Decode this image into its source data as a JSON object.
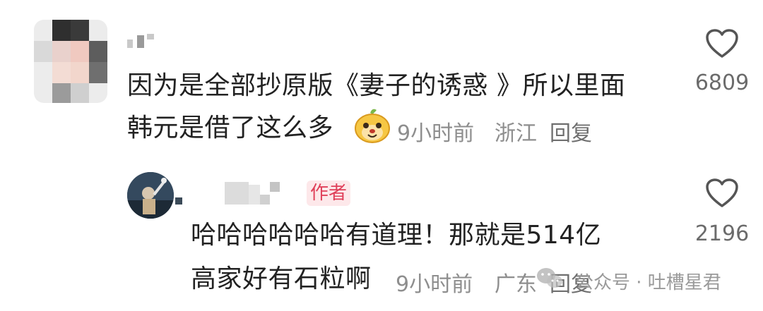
{
  "comments": [
    {
      "text_line1": "因为是全部抄原版《妻子的诱惑 》所以里面",
      "text_line2": "韩元是借了这么多",
      "emoji_icon": "cute-face-emoji",
      "time": "9小时前",
      "location": "浙江",
      "reply_label": "回复",
      "like_count": "6809"
    },
    {
      "badge": "作者",
      "text_line1": "哈哈哈哈哈哈有道理！那就是514亿",
      "text_line2": "高家好有石粒啊",
      "time": "9小时前",
      "location": "广东",
      "reply_label": "回复",
      "like_count": "2196"
    }
  ],
  "watermark": {
    "text": "公众号 · 吐槽星君",
    "icon": "wechat-icon"
  },
  "colors": {
    "text": "#222222",
    "meta": "#8e8e8e",
    "badge_bg": "#fde8ea",
    "badge_text": "#e0405a"
  }
}
